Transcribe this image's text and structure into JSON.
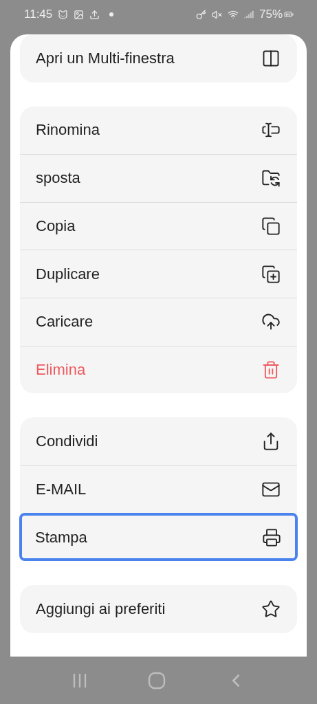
{
  "status_bar": {
    "time": "11:45",
    "battery": "75%"
  },
  "groups": [
    {
      "items": [
        {
          "label": "Apri un Multi-finestra",
          "kind": "split",
          "destructive": false,
          "focused": false
        }
      ]
    },
    {
      "items": [
        {
          "label": "Rinomina",
          "kind": "rename",
          "destructive": false,
          "focused": false
        },
        {
          "label": "sposta",
          "kind": "move",
          "destructive": false,
          "focused": false
        },
        {
          "label": "Copia",
          "kind": "copy",
          "destructive": false,
          "focused": false
        },
        {
          "label": "Duplicare",
          "kind": "duplicate",
          "destructive": false,
          "focused": false
        },
        {
          "label": "Caricare",
          "kind": "upload",
          "destructive": false,
          "focused": false
        },
        {
          "label": "Elimina",
          "kind": "delete",
          "destructive": true,
          "focused": false
        }
      ]
    },
    {
      "items": [
        {
          "label": "Condividi",
          "kind": "share",
          "destructive": false,
          "focused": false
        },
        {
          "label": "E-MAIL",
          "kind": "mail",
          "destructive": false,
          "focused": false
        },
        {
          "label": "Stampa",
          "kind": "print",
          "destructive": false,
          "focused": true
        }
      ]
    },
    {
      "items": [
        {
          "label": "Aggiungi ai preferiti",
          "kind": "favorite",
          "destructive": false,
          "focused": false
        }
      ]
    }
  ]
}
